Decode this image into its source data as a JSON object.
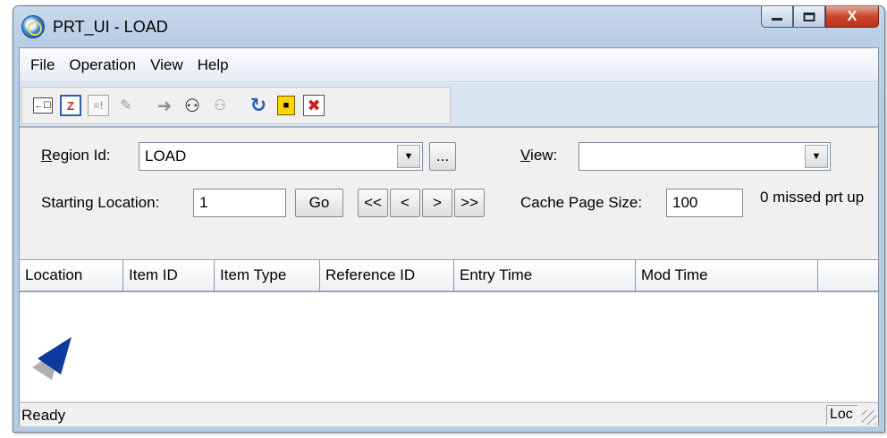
{
  "window": {
    "title": "PRT_UI - LOAD",
    "caption_buttons": {
      "minimize": "",
      "maximize": "",
      "close": "X"
    }
  },
  "menu": [
    {
      "label": "File"
    },
    {
      "label": "Operation"
    },
    {
      "label": "View"
    },
    {
      "label": "Help"
    }
  ],
  "toolbar": {
    "new_glyph": "←☐",
    "calendar_glyph": "Z",
    "doc_glyph": "≡!",
    "edit_glyph": "✎",
    "arrow_glyph": "➜",
    "find_glyph": "⚇",
    "findnext_glyph": "⚇",
    "refresh_glyph": "↻",
    "lock_glyph": "■",
    "delete_glyph": "✖"
  },
  "form": {
    "region_label_prefix": "R",
    "region_label_rest": "egion Id:",
    "region_value": "LOAD",
    "browse_label": "...",
    "view_label_prefix": "V",
    "view_label_rest": "iew:",
    "view_value": "",
    "starting_label": "Starting Location:",
    "starting_value": "1",
    "go_label": "Go",
    "nav_first": "<<",
    "nav_prev": "<",
    "nav_next": ">",
    "nav_last": ">>",
    "cache_label": "Cache Page Size:",
    "cache_value": "100",
    "missed_text": "0 missed prt up"
  },
  "grid": {
    "columns": [
      "Location",
      "Item ID",
      "Item Type",
      "Reference ID",
      "Entry Time",
      "Mod Time",
      ""
    ],
    "rows": []
  },
  "statusbar": {
    "status": "Ready",
    "pane": "Loc"
  },
  "colors": {
    "frame": "#b8cde6",
    "close_button": "#c9462d",
    "sort_marker": "#0d3a9e"
  }
}
